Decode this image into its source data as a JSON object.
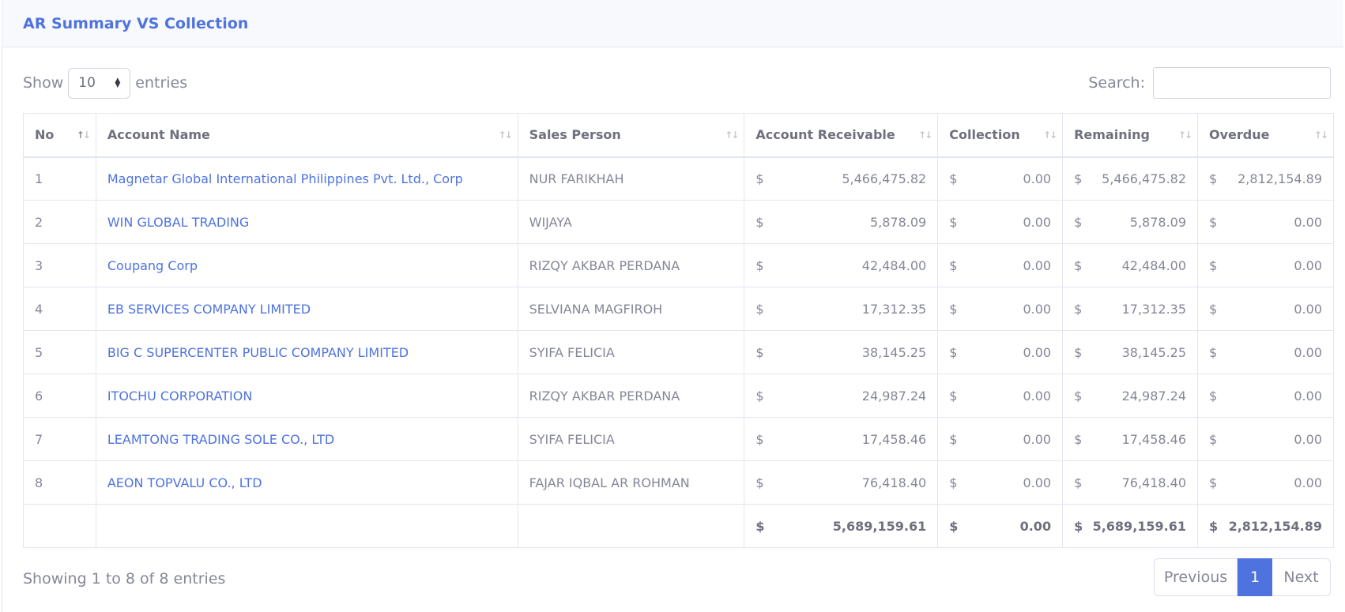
{
  "header": {
    "title": "AR Summary VS Collection"
  },
  "length_control": {
    "show_label": "Show",
    "value": "10",
    "entries_label": "entries"
  },
  "search": {
    "label": "Search:",
    "value": ""
  },
  "table": {
    "columns": [
      "No",
      "Account Name",
      "Sales Person",
      "Account Receivable",
      "Collection",
      "Remaining",
      "Overdue"
    ],
    "currency": "$",
    "rows": [
      {
        "no": "1",
        "account": "Magnetar Global International Philippines Pvt. Ltd., Corp",
        "sales": "NUR FARIKHAH",
        "ar": "5,466,475.82",
        "collection": "0.00",
        "remaining": "5,466,475.82",
        "overdue": "2,812,154.89"
      },
      {
        "no": "2",
        "account": "WIN GLOBAL TRADING",
        "sales": "WIJAYA",
        "ar": "5,878.09",
        "collection": "0.00",
        "remaining": "5,878.09",
        "overdue": "0.00"
      },
      {
        "no": "3",
        "account": "Coupang Corp",
        "sales": "RIZQY AKBAR PERDANA",
        "ar": "42,484.00",
        "collection": "0.00",
        "remaining": "42,484.00",
        "overdue": "0.00"
      },
      {
        "no": "4",
        "account": "EB SERVICES COMPANY LIMITED",
        "sales": "SELVIANA MAGFIROH",
        "ar": "17,312.35",
        "collection": "0.00",
        "remaining": "17,312.35",
        "overdue": "0.00"
      },
      {
        "no": "5",
        "account": "BIG C SUPERCENTER PUBLIC COMPANY LIMITED",
        "sales": "SYIFA FELICIA",
        "ar": "38,145.25",
        "collection": "0.00",
        "remaining": "38,145.25",
        "overdue": "0.00"
      },
      {
        "no": "6",
        "account": "ITOCHU CORPORATION",
        "sales": "RIZQY AKBAR PERDANA",
        "ar": "24,987.24",
        "collection": "0.00",
        "remaining": "24,987.24",
        "overdue": "0.00"
      },
      {
        "no": "7",
        "account": "LEAMTONG TRADING SOLE CO., LTD",
        "sales": "SYIFA FELICIA",
        "ar": "17,458.46",
        "collection": "0.00",
        "remaining": "17,458.46",
        "overdue": "0.00"
      },
      {
        "no": "8",
        "account": "AEON TOPVALU CO., LTD",
        "sales": "FAJAR IQBAL AR ROHMAN",
        "ar": "76,418.40",
        "collection": "0.00",
        "remaining": "76,418.40",
        "overdue": "0.00"
      }
    ],
    "totals": {
      "ar": "5,689,159.61",
      "collection": "0.00",
      "remaining": "5,689,159.61",
      "overdue": "2,812,154.89"
    }
  },
  "footer": {
    "info": "Showing 1 to 8 of 8 entries",
    "previous": "Previous",
    "current_page": "1",
    "next": "Next"
  },
  "colors": {
    "accent": "#4e73df",
    "text": "#858796",
    "border": "#e3e6f0"
  }
}
